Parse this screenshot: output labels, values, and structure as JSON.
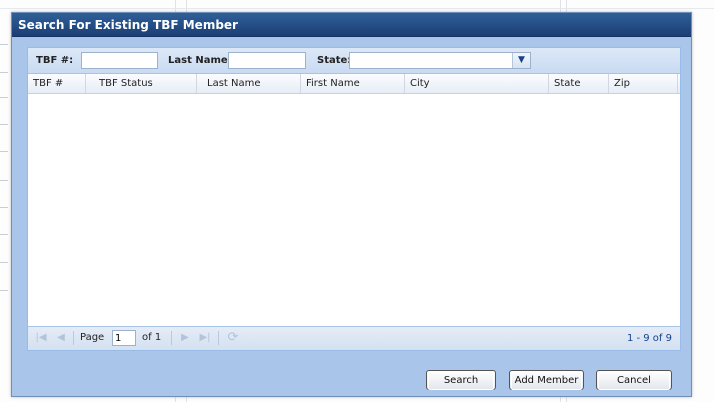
{
  "dialog": {
    "title": "Search For Existing TBF Member"
  },
  "filters": {
    "tbf_label": "TBF #:",
    "tbf_value": "",
    "last_name_label": "Last Name:",
    "last_name_value": "",
    "state_label": "State:",
    "state_value": ""
  },
  "grid": {
    "columns": [
      "TBF #",
      "TBF Status",
      "Last Name",
      "First Name",
      "City",
      "State",
      "Zip"
    ],
    "rows": []
  },
  "pager": {
    "page_label": "Page",
    "page_value": "1",
    "of_label": "of 1",
    "count_text": "1 - 9 of 9"
  },
  "buttons": {
    "search": "Search",
    "add_member": "Add Member",
    "cancel": "Cancel"
  },
  "colors": {
    "title_bar": "#1b3f74",
    "dialog_body": "#a9c6ea"
  }
}
